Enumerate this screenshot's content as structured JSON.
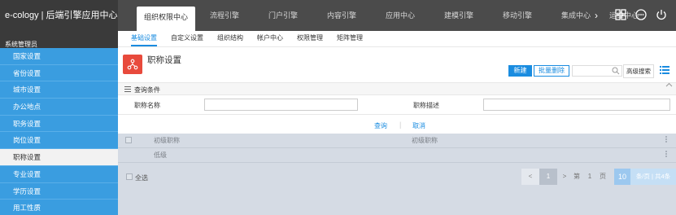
{
  "app": {
    "brand": "e-cology | 后端引擎应用中心"
  },
  "top_tabs": [
    {
      "label": "组织权限中心",
      "active": true
    },
    {
      "label": "流程引擎"
    },
    {
      "label": "门户引擎"
    },
    {
      "label": "内容引擎"
    },
    {
      "label": "应用中心"
    },
    {
      "label": "建模引擎"
    },
    {
      "label": "移动引擎"
    },
    {
      "label": "集成中心"
    },
    {
      "label": "运维中心"
    }
  ],
  "top_tabs_more": "›",
  "top_icons": [
    "grid-icon",
    "more-icon",
    "power-icon"
  ],
  "sidebar": {
    "header": "系统管理员",
    "items": [
      {
        "label": "国家设置"
      },
      {
        "label": "省份设置"
      },
      {
        "label": "城市设置"
      },
      {
        "label": "办公地点"
      },
      {
        "label": "职务设置"
      },
      {
        "label": "岗位设置"
      },
      {
        "label": "职称设置",
        "active": true
      },
      {
        "label": "专业设置"
      },
      {
        "label": "学历设置"
      },
      {
        "label": "用工性质"
      }
    ]
  },
  "subnav": [
    {
      "label": "基础设置",
      "active": true
    },
    {
      "label": "自定义设置"
    },
    {
      "label": "组织结构"
    },
    {
      "label": "帐户中心"
    },
    {
      "label": "权限管理"
    },
    {
      "label": "矩阵管理"
    }
  ],
  "page": {
    "title": "职称设置",
    "new_label": "新建",
    "batch_delete_label": "批量删除",
    "search_value": "",
    "advanced_search_label": "高级搜索"
  },
  "query": {
    "header": "查询条件",
    "field1_label": "职称名称",
    "field1_value": "",
    "field2_label": "职称描述",
    "field2_value": "",
    "search_label": "查询",
    "separator": "|",
    "cancel_label": "取消"
  },
  "table": {
    "rows": [
      {
        "name": "初级职称",
        "desc": "初级职称"
      },
      {
        "name": "低级",
        "desc": ""
      }
    ],
    "select_all_label": "全选"
  },
  "pager": {
    "prev": "<",
    "current": "1",
    "next": ">",
    "label_di": "第",
    "page_input": "1",
    "label_ye": "页",
    "page_size": "10",
    "info": "条/页 | 共4条"
  },
  "colors": {
    "accent": "#1a8ce0",
    "sidebar": "#3a9de0",
    "topbar": "#4b4b4b",
    "page_icon": "#e84a3c"
  }
}
